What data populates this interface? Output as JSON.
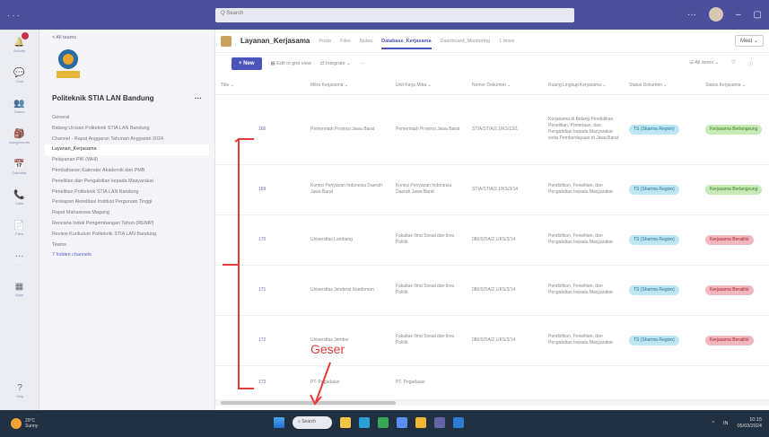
{
  "titlebar": {
    "search_placeholder": "Q Search",
    "dots": "· · ·",
    "more": "···",
    "minimize": "–",
    "restore": "▢"
  },
  "rail": [
    {
      "icon": "bell-icon",
      "label": "Activity"
    },
    {
      "icon": "chat-icon",
      "label": "Chat"
    },
    {
      "icon": "teams-icon",
      "label": "Teams"
    },
    {
      "icon": "assignments-icon",
      "label": "Assignments"
    },
    {
      "icon": "calendar-icon",
      "label": "Calendar"
    },
    {
      "icon": "calls-icon",
      "label": "Calls"
    },
    {
      "icon": "files-icon",
      "label": "Files"
    },
    {
      "icon": "more-icon",
      "label": "..."
    },
    {
      "icon": "apps-icon",
      "label": "Apps"
    },
    {
      "icon": "help-icon",
      "label": "Help"
    }
  ],
  "sidebar": {
    "back": "< All teams",
    "team_name": "Politeknik STIA LAN Bandung",
    "team_more": "···",
    "channels": [
      "General",
      "Bidang Urusan Politeknik STIA LAN Bandung",
      "Channel - Rapat Anggaran Tahunan Anggaran 2024",
      "Layanan_Kerjasama",
      "Pelayanan PIK (WHI)",
      "Pembahasan Kalender Akademik dan PMB",
      "Penelitian dan Pengabdian kepada Masyarakat",
      "Penelitian Politeknik STIA LAN Bandung",
      "Persiapan Akreditasi Institusi Perguruan Tinggi",
      "Rapat Mahasiswa Magang",
      "Rencana Induk Pengembangan Tahun (RENIP)",
      "Review Kurikulum Politeknik STIA LAN Bandung",
      "Teams",
      "7 hidden channels"
    ],
    "active_index": 3
  },
  "channel": {
    "name": "Layanan_Kerjasama",
    "tabs": [
      "Posts",
      "Files",
      "Notes",
      "Database_Kerjasama",
      "Dashboard_Monitoring",
      "1 more"
    ],
    "active_tab": 3,
    "meet_label": "Meet",
    "meet_chevron": "⌄"
  },
  "toolbar": {
    "new_label": "+ New",
    "edit_label": "Edit in grid view",
    "integrate_label": "Integrate",
    "more": "···",
    "all_items": "All items",
    "filter_icon": "filter-icon",
    "info_icon": "info-icon"
  },
  "table": {
    "headers": [
      "Title",
      "Mitra Kerjasama",
      "Unit Kerja Mitra",
      "Nomor Dokumen",
      "Ruang Lingkup Kerjasama",
      "Status Dokumen",
      "Status Kerjasama"
    ],
    "rows": [
      {
        "title": "166",
        "mitra": "Pemerintah Provinsi Jawa Barat",
        "unit": "Pemerintah Provinsi Jawa Barat",
        "nomor": "STIA/STIA/2.1/KS/13/1",
        "lingkup": "Kerjasama di Bidang Pendidikan, Penelitian, Pemetaan, dan Pengabdian kepada Masyarakat serta Pemberdayaan di Jawa Barat",
        "status_dok": "TS (Sharma Region)",
        "status_ks": "Kerjasama Berlangsung",
        "status_color": "green"
      },
      {
        "title": "169",
        "mitra": "Komisi Penyiaran Indonesia Daerah Jawa Barat",
        "unit": "Komisi Penyiaran Indonesia Daerah Jawa Barat",
        "nomor": "STIA/STIA/2.1/KS/3/14",
        "lingkup": "Pendidikan, Penelitian, dan Pengabdian kepada Masyarakat",
        "status_dok": "TS (Sharma Region)",
        "status_ks": "Kerjasama Berlangsung",
        "status_color": "green"
      },
      {
        "title": "170",
        "mitra": "Universitas Lambung",
        "unit": "Fakultas Ilmu Sosial dan Ilmu Politik",
        "nomor": "080/STIA/2.1/KS/3/14",
        "lingkup": "Pendidikan, Penelitian, dan Pengabdian kepada Masyarakat",
        "status_dok": "TS (Sharma Region)",
        "status_ks": "Kerjasama Berakhir",
        "status_color": "red"
      },
      {
        "title": "171",
        "mitra": "Universitas Jenderal Soedirman",
        "unit": "Fakultas Ilmu Sosial dan Ilmu Politik",
        "nomor": "080/STIA/2.1/KS/3/14",
        "lingkup": "Pendidikan, Penelitian, dan Pengabdian kepada Masyarakat",
        "status_dok": "TS (Sharma Region)",
        "status_ks": "Kerjasama Berakhir",
        "status_color": "red"
      },
      {
        "title": "172",
        "mitra": "Universitas Jember",
        "unit": "Fakultas Ilmu Sosial dan Ilmu Politik",
        "nomor": "080/STIA/2.1/KS/3/14",
        "lingkup": "Pendidikan, Penelitian, dan Pengabdian kepada Masyarakat",
        "status_dok": "TS (Sharma Region)",
        "status_ks": "Kerjasama Berakhir",
        "status_color": "red"
      },
      {
        "title": "173",
        "mitra": "PT. Pegadaian",
        "unit": "PT. Pegadaian",
        "nomor": "",
        "lingkup": "",
        "status_dok": "",
        "status_ks": "",
        "status_color": ""
      }
    ]
  },
  "taskbar": {
    "weather_temp": "29°C",
    "weather_desc": "Sunny",
    "search_label": "Search",
    "tray_lang": "IN",
    "tray_chevron": "^",
    "time": "10:15",
    "date": "05/03/2024",
    "apps": [
      {
        "icon": "explorer-icon",
        "color": "#f4c542"
      },
      {
        "icon": "edge-icon",
        "color": "#2a9fd8"
      },
      {
        "icon": "chrome-icon",
        "color": "#3aa757"
      },
      {
        "icon": "store-icon",
        "color": "#5b8ef4"
      },
      {
        "icon": "mail-icon",
        "color": "#f2b632"
      },
      {
        "icon": "teams-app-icon",
        "color": "#6264a7"
      },
      {
        "icon": "word-icon",
        "color": "#2b7cd3"
      }
    ]
  },
  "annotation": {
    "label": "Geser",
    "color": "#e23b3b"
  }
}
